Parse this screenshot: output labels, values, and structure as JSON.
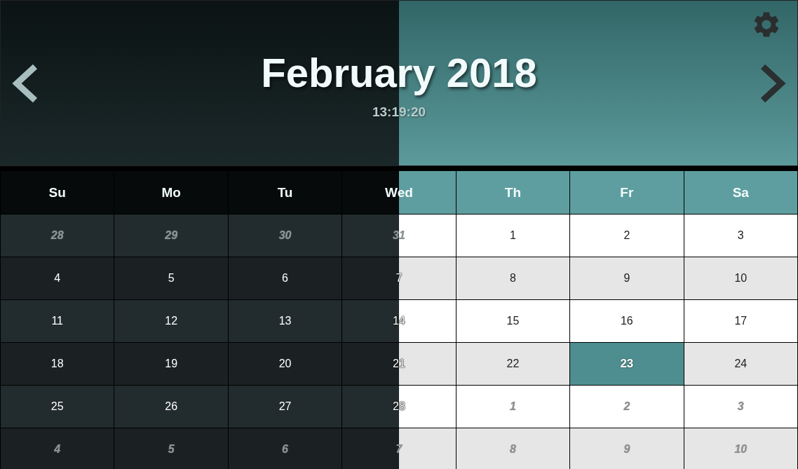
{
  "header": {
    "title": "February 2018",
    "time": "13:19:20"
  },
  "weekdays": [
    {
      "label": "Su",
      "kind": "dark"
    },
    {
      "label": "Mo",
      "kind": "dark"
    },
    {
      "label": "Tu",
      "kind": "dark"
    },
    {
      "label": "Wed",
      "kind": "split"
    },
    {
      "label": "Th",
      "kind": "light"
    },
    {
      "label": "Fr",
      "kind": "light"
    },
    {
      "label": "Sa",
      "kind": "light"
    }
  ],
  "weeks": [
    [
      {
        "day": "28",
        "kind": "other",
        "selected": false
      },
      {
        "day": "29",
        "kind": "other",
        "selected": false
      },
      {
        "day": "30",
        "kind": "other",
        "selected": false
      },
      {
        "day": "31",
        "kind": "other",
        "selected": false
      },
      {
        "day": "1",
        "kind": "current",
        "selected": false
      },
      {
        "day": "2",
        "kind": "current",
        "selected": false
      },
      {
        "day": "3",
        "kind": "current",
        "selected": false
      }
    ],
    [
      {
        "day": "4",
        "kind": "current",
        "selected": false
      },
      {
        "day": "5",
        "kind": "current",
        "selected": false
      },
      {
        "day": "6",
        "kind": "current",
        "selected": false
      },
      {
        "day": "7",
        "kind": "current",
        "selected": false
      },
      {
        "day": "8",
        "kind": "current",
        "selected": false
      },
      {
        "day": "9",
        "kind": "current",
        "selected": false
      },
      {
        "day": "10",
        "kind": "current",
        "selected": false
      }
    ],
    [
      {
        "day": "11",
        "kind": "current",
        "selected": false
      },
      {
        "day": "12",
        "kind": "current",
        "selected": false
      },
      {
        "day": "13",
        "kind": "current",
        "selected": false
      },
      {
        "day": "14",
        "kind": "current",
        "selected": false
      },
      {
        "day": "15",
        "kind": "current",
        "selected": false
      },
      {
        "day": "16",
        "kind": "current",
        "selected": false
      },
      {
        "day": "17",
        "kind": "current",
        "selected": false
      }
    ],
    [
      {
        "day": "18",
        "kind": "current",
        "selected": false
      },
      {
        "day": "19",
        "kind": "current",
        "selected": false
      },
      {
        "day": "20",
        "kind": "current",
        "selected": false
      },
      {
        "day": "21",
        "kind": "current",
        "selected": false
      },
      {
        "day": "22",
        "kind": "current",
        "selected": false
      },
      {
        "day": "23",
        "kind": "current",
        "selected": true
      },
      {
        "day": "24",
        "kind": "current",
        "selected": false
      }
    ],
    [
      {
        "day": "25",
        "kind": "current",
        "selected": false
      },
      {
        "day": "26",
        "kind": "current",
        "selected": false
      },
      {
        "day": "27",
        "kind": "current",
        "selected": false
      },
      {
        "day": "28",
        "kind": "current",
        "selected": false
      },
      {
        "day": "1",
        "kind": "other",
        "selected": false
      },
      {
        "day": "2",
        "kind": "other",
        "selected": false
      },
      {
        "day": "3",
        "kind": "other",
        "selected": false
      }
    ],
    [
      {
        "day": "4",
        "kind": "other",
        "selected": false
      },
      {
        "day": "5",
        "kind": "other",
        "selected": false
      },
      {
        "day": "6",
        "kind": "other",
        "selected": false
      },
      {
        "day": "7",
        "kind": "other",
        "selected": false
      },
      {
        "day": "8",
        "kind": "other",
        "selected": false
      },
      {
        "day": "9",
        "kind": "other",
        "selected": false
      },
      {
        "day": "10",
        "kind": "other",
        "selected": false
      }
    ]
  ]
}
